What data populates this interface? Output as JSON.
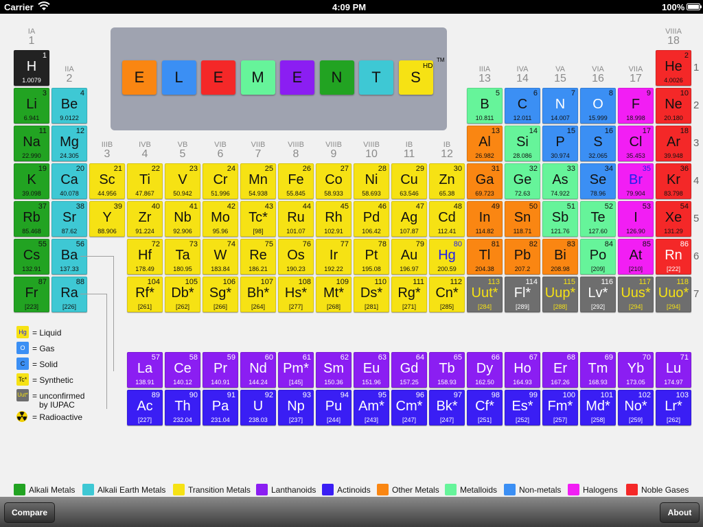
{
  "status": {
    "carrier": "Carrier",
    "time": "4:09 PM",
    "battery": "100%"
  },
  "title_letters": [
    "E",
    "L",
    "E",
    "M",
    "E",
    "N",
    "T",
    "S"
  ],
  "title_hd": "HD",
  "title_tm": "TM",
  "colors": {
    "alkali": "#22a322",
    "alkaline": "#3ec8d4",
    "transition": "#f6e214",
    "lanthanoid": "#8b1ef2",
    "actinoid": "#3a1ef4",
    "other": "#fa8612",
    "metalloid": "#66f49a",
    "nonmetal": "#3b8ff4",
    "halogen": "#f21ef4",
    "noble": "#f42828",
    "unknown": "#6e6e6e",
    "hydrogen": "#222222"
  },
  "group_labels": [
    {
      "roman": "IA",
      "arabic": "1"
    },
    {
      "roman": "IIA",
      "arabic": "2"
    },
    {
      "roman": "IIIB",
      "arabic": "3"
    },
    {
      "roman": "IVB",
      "arabic": "4"
    },
    {
      "roman": "VB",
      "arabic": "5"
    },
    {
      "roman": "VIB",
      "arabic": "6"
    },
    {
      "roman": "VIIB",
      "arabic": "7"
    },
    {
      "roman": "VIIIB",
      "arabic": "8"
    },
    {
      "roman": "VIIIB",
      "arabic": "9"
    },
    {
      "roman": "VIIIB",
      "arabic": "10"
    },
    {
      "roman": "IB",
      "arabic": "11"
    },
    {
      "roman": "IB",
      "arabic": "12"
    },
    {
      "roman": "IIIA",
      "arabic": "13"
    },
    {
      "roman": "IVA",
      "arabic": "14"
    },
    {
      "roman": "VA",
      "arabic": "15"
    },
    {
      "roman": "VIA",
      "arabic": "16"
    },
    {
      "roman": "VIIA",
      "arabic": "17"
    },
    {
      "roman": "VIIIA",
      "arabic": "18"
    }
  ],
  "periods": [
    "1",
    "2",
    "3",
    "4",
    "5",
    "6",
    "7"
  ],
  "elements": [
    {
      "n": "1",
      "s": "H",
      "m": "1.0079",
      "r": 1,
      "c": 1,
      "t": "hydrogen"
    },
    {
      "n": "2",
      "s": "He",
      "m": "4.0026",
      "r": 1,
      "c": 18,
      "t": "noble"
    },
    {
      "n": "3",
      "s": "Li",
      "m": "6.941",
      "r": 2,
      "c": 1,
      "t": "alkali"
    },
    {
      "n": "4",
      "s": "Be",
      "m": "9.0122",
      "r": 2,
      "c": 2,
      "t": "alkaline"
    },
    {
      "n": "5",
      "s": "B",
      "m": "10.811",
      "r": 2,
      "c": 13,
      "t": "metalloid"
    },
    {
      "n": "6",
      "s": "C",
      "m": "12.011",
      "r": 2,
      "c": 14,
      "t": "nonmetal"
    },
    {
      "n": "7",
      "s": "N",
      "m": "14.007",
      "r": 2,
      "c": 15,
      "t": "nonmetal"
    },
    {
      "n": "8",
      "s": "O",
      "m": "15.999",
      "r": 2,
      "c": 16,
      "t": "nonmetal"
    },
    {
      "n": "9",
      "s": "F",
      "m": "18.998",
      "r": 2,
      "c": 17,
      "t": "halogen"
    },
    {
      "n": "10",
      "s": "Ne",
      "m": "20.180",
      "r": 2,
      "c": 18,
      "t": "noble"
    },
    {
      "n": "11",
      "s": "Na",
      "m": "22.990",
      "r": 3,
      "c": 1,
      "t": "alkali"
    },
    {
      "n": "12",
      "s": "Mg",
      "m": "24.305",
      "r": 3,
      "c": 2,
      "t": "alkaline"
    },
    {
      "n": "13",
      "s": "Al",
      "m": "26.982",
      "r": 3,
      "c": 13,
      "t": "other"
    },
    {
      "n": "14",
      "s": "Si",
      "m": "28.086",
      "r": 3,
      "c": 14,
      "t": "metalloid"
    },
    {
      "n": "15",
      "s": "P",
      "m": "30.974",
      "r": 3,
      "c": 15,
      "t": "nonmetal"
    },
    {
      "n": "16",
      "s": "S",
      "m": "32.065",
      "r": 3,
      "c": 16,
      "t": "nonmetal"
    },
    {
      "n": "17",
      "s": "Cl",
      "m": "35.453",
      "r": 3,
      "c": 17,
      "t": "halogen"
    },
    {
      "n": "18",
      "s": "Ar",
      "m": "39.948",
      "r": 3,
      "c": 18,
      "t": "noble"
    },
    {
      "n": "19",
      "s": "K",
      "m": "39.098",
      "r": 4,
      "c": 1,
      "t": "alkali"
    },
    {
      "n": "20",
      "s": "Ca",
      "m": "40.078",
      "r": 4,
      "c": 2,
      "t": "alkaline"
    },
    {
      "n": "21",
      "s": "Sc",
      "m": "44.956",
      "r": 4,
      "c": 3,
      "t": "transition"
    },
    {
      "n": "22",
      "s": "Ti",
      "m": "47.867",
      "r": 4,
      "c": 4,
      "t": "transition"
    },
    {
      "n": "23",
      "s": "V",
      "m": "50.942",
      "r": 4,
      "c": 5,
      "t": "transition"
    },
    {
      "n": "24",
      "s": "Cr",
      "m": "51.996",
      "r": 4,
      "c": 6,
      "t": "transition"
    },
    {
      "n": "25",
      "s": "Mn",
      "m": "54.938",
      "r": 4,
      "c": 7,
      "t": "transition"
    },
    {
      "n": "26",
      "s": "Fe",
      "m": "55.845",
      "r": 4,
      "c": 8,
      "t": "transition"
    },
    {
      "n": "27",
      "s": "Co",
      "m": "58.933",
      "r": 4,
      "c": 9,
      "t": "transition"
    },
    {
      "n": "28",
      "s": "Ni",
      "m": "58.693",
      "r": 4,
      "c": 10,
      "t": "transition"
    },
    {
      "n": "29",
      "s": "Cu",
      "m": "63.546",
      "r": 4,
      "c": 11,
      "t": "transition"
    },
    {
      "n": "30",
      "s": "Zn",
      "m": "65.38",
      "r": 4,
      "c": 12,
      "t": "transition"
    },
    {
      "n": "31",
      "s": "Ga",
      "m": "69.723",
      "r": 4,
      "c": 13,
      "t": "other"
    },
    {
      "n": "32",
      "s": "Ge",
      "m": "72.63",
      "r": 4,
      "c": 14,
      "t": "metalloid"
    },
    {
      "n": "33",
      "s": "As",
      "m": "74.922",
      "r": 4,
      "c": 15,
      "t": "metalloid"
    },
    {
      "n": "34",
      "s": "Se",
      "m": "78.96",
      "r": 4,
      "c": 16,
      "t": "nonmetal"
    },
    {
      "n": "35",
      "s": "Br",
      "m": "79.904",
      "r": 4,
      "c": 17,
      "t": "halogen",
      "blue": true
    },
    {
      "n": "36",
      "s": "Kr",
      "m": "83.798",
      "r": 4,
      "c": 18,
      "t": "noble"
    },
    {
      "n": "37",
      "s": "Rb",
      "m": "85.468",
      "r": 5,
      "c": 1,
      "t": "alkali"
    },
    {
      "n": "38",
      "s": "Sr",
      "m": "87.62",
      "r": 5,
      "c": 2,
      "t": "alkaline"
    },
    {
      "n": "39",
      "s": "Y",
      "m": "88.906",
      "r": 5,
      "c": 3,
      "t": "transition"
    },
    {
      "n": "40",
      "s": "Zr",
      "m": "91.224",
      "r": 5,
      "c": 4,
      "t": "transition"
    },
    {
      "n": "41",
      "s": "Nb",
      "m": "92.906",
      "r": 5,
      "c": 5,
      "t": "transition"
    },
    {
      "n": "42",
      "s": "Mo",
      "m": "95.96",
      "r": 5,
      "c": 6,
      "t": "transition"
    },
    {
      "n": "43",
      "s": "Tc*",
      "m": "[98]",
      "r": 5,
      "c": 7,
      "t": "transition"
    },
    {
      "n": "44",
      "s": "Ru",
      "m": "101.07",
      "r": 5,
      "c": 8,
      "t": "transition"
    },
    {
      "n": "45",
      "s": "Rh",
      "m": "102.91",
      "r": 5,
      "c": 9,
      "t": "transition"
    },
    {
      "n": "46",
      "s": "Pd",
      "m": "106.42",
      "r": 5,
      "c": 10,
      "t": "transition"
    },
    {
      "n": "47",
      "s": "Ag",
      "m": "107.87",
      "r": 5,
      "c": 11,
      "t": "transition"
    },
    {
      "n": "48",
      "s": "Cd",
      "m": "112.41",
      "r": 5,
      "c": 12,
      "t": "transition"
    },
    {
      "n": "49",
      "s": "In",
      "m": "114.82",
      "r": 5,
      "c": 13,
      "t": "other"
    },
    {
      "n": "50",
      "s": "Sn",
      "m": "118.71",
      "r": 5,
      "c": 14,
      "t": "other"
    },
    {
      "n": "51",
      "s": "Sb",
      "m": "121.76",
      "r": 5,
      "c": 15,
      "t": "metalloid"
    },
    {
      "n": "52",
      "s": "Te",
      "m": "127.60",
      "r": 5,
      "c": 16,
      "t": "metalloid"
    },
    {
      "n": "53",
      "s": "I",
      "m": "126.90",
      "r": 5,
      "c": 17,
      "t": "halogen"
    },
    {
      "n": "54",
      "s": "Xe",
      "m": "131.29",
      "r": 5,
      "c": 18,
      "t": "noble"
    },
    {
      "n": "55",
      "s": "Cs",
      "m": "132.91",
      "r": 6,
      "c": 1,
      "t": "alkali"
    },
    {
      "n": "56",
      "s": "Ba",
      "m": "137.33",
      "r": 6,
      "c": 2,
      "t": "alkaline"
    },
    {
      "n": "72",
      "s": "Hf",
      "m": "178.49",
      "r": 6,
      "c": 4,
      "t": "transition"
    },
    {
      "n": "73",
      "s": "Ta",
      "m": "180.95",
      "r": 6,
      "c": 5,
      "t": "transition"
    },
    {
      "n": "74",
      "s": "W",
      "m": "183.84",
      "r": 6,
      "c": 6,
      "t": "transition"
    },
    {
      "n": "75",
      "s": "Re",
      "m": "186.21",
      "r": 6,
      "c": 7,
      "t": "transition"
    },
    {
      "n": "76",
      "s": "Os",
      "m": "190.23",
      "r": 6,
      "c": 8,
      "t": "transition"
    },
    {
      "n": "77",
      "s": "Ir",
      "m": "192.22",
      "r": 6,
      "c": 9,
      "t": "transition"
    },
    {
      "n": "78",
      "s": "Pt",
      "m": "195.08",
      "r": 6,
      "c": 10,
      "t": "transition"
    },
    {
      "n": "79",
      "s": "Au",
      "m": "196.97",
      "r": 6,
      "c": 11,
      "t": "transition"
    },
    {
      "n": "80",
      "s": "Hg",
      "m": "200.59",
      "r": 6,
      "c": 12,
      "t": "transition",
      "blue": true
    },
    {
      "n": "81",
      "s": "Tl",
      "m": "204.38",
      "r": 6,
      "c": 13,
      "t": "other"
    },
    {
      "n": "82",
      "s": "Pb",
      "m": "207.2",
      "r": 6,
      "c": 14,
      "t": "other"
    },
    {
      "n": "83",
      "s": "Bi",
      "m": "208.98",
      "r": 6,
      "c": 15,
      "t": "other"
    },
    {
      "n": "84",
      "s": "Po",
      "m": "[209]",
      "r": 6,
      "c": 16,
      "t": "metalloid"
    },
    {
      "n": "85",
      "s": "At",
      "m": "[210]",
      "r": 6,
      "c": 17,
      "t": "halogen"
    },
    {
      "n": "86",
      "s": "Rn",
      "m": "[222]",
      "r": 6,
      "c": 18,
      "t": "noble",
      "white": true
    },
    {
      "n": "87",
      "s": "Fr",
      "m": "[223]",
      "r": 7,
      "c": 1,
      "t": "alkali"
    },
    {
      "n": "88",
      "s": "Ra",
      "m": "[226]",
      "r": 7,
      "c": 2,
      "t": "alkaline"
    },
    {
      "n": "104",
      "s": "Rf*",
      "m": "[261]",
      "r": 7,
      "c": 4,
      "t": "transition"
    },
    {
      "n": "105",
      "s": "Db*",
      "m": "[262]",
      "r": 7,
      "c": 5,
      "t": "transition"
    },
    {
      "n": "106",
      "s": "Sg*",
      "m": "[266]",
      "r": 7,
      "c": 6,
      "t": "transition"
    },
    {
      "n": "107",
      "s": "Bh*",
      "m": "[264]",
      "r": 7,
      "c": 7,
      "t": "transition"
    },
    {
      "n": "108",
      "s": "Hs*",
      "m": "[277]",
      "r": 7,
      "c": 8,
      "t": "transition"
    },
    {
      "n": "109",
      "s": "Mt*",
      "m": "[268]",
      "r": 7,
      "c": 9,
      "t": "transition"
    },
    {
      "n": "110",
      "s": "Ds*",
      "m": "[281]",
      "r": 7,
      "c": 10,
      "t": "transition"
    },
    {
      "n": "111",
      "s": "Rg*",
      "m": "[271]",
      "r": 7,
      "c": 11,
      "t": "transition"
    },
    {
      "n": "112",
      "s": "Cn*",
      "m": "[285]",
      "r": 7,
      "c": 12,
      "t": "transition"
    },
    {
      "n": "113",
      "s": "Uut*",
      "m": "[284]",
      "r": 7,
      "c": 13,
      "t": "unknown",
      "yellowtxt": true
    },
    {
      "n": "114",
      "s": "Fl*",
      "m": "[289]",
      "r": 7,
      "c": 14,
      "t": "unknown"
    },
    {
      "n": "115",
      "s": "Uup*",
      "m": "[288]",
      "r": 7,
      "c": 15,
      "t": "unknown",
      "yellowtxt": true
    },
    {
      "n": "116",
      "s": "Lv*",
      "m": "[292]",
      "r": 7,
      "c": 16,
      "t": "unknown"
    },
    {
      "n": "117",
      "s": "Uus*",
      "m": "[294]",
      "r": 7,
      "c": 17,
      "t": "unknown",
      "yellowtxt": true
    },
    {
      "n": "118",
      "s": "Uuo*",
      "m": "[294]",
      "r": 7,
      "c": 18,
      "t": "unknown",
      "yellowtxt": true
    },
    {
      "n": "57",
      "s": "La",
      "m": "138.91",
      "r": 9,
      "c": 4,
      "t": "lanthanoid"
    },
    {
      "n": "58",
      "s": "Ce",
      "m": "140.12",
      "r": 9,
      "c": 5,
      "t": "lanthanoid"
    },
    {
      "n": "59",
      "s": "Pr",
      "m": "140.91",
      "r": 9,
      "c": 6,
      "t": "lanthanoid"
    },
    {
      "n": "60",
      "s": "Nd",
      "m": "144.24",
      "r": 9,
      "c": 7,
      "t": "lanthanoid"
    },
    {
      "n": "61",
      "s": "Pm*",
      "m": "[145]",
      "r": 9,
      "c": 8,
      "t": "lanthanoid"
    },
    {
      "n": "62",
      "s": "Sm",
      "m": "150.36",
      "r": 9,
      "c": 9,
      "t": "lanthanoid"
    },
    {
      "n": "63",
      "s": "Eu",
      "m": "151.96",
      "r": 9,
      "c": 10,
      "t": "lanthanoid"
    },
    {
      "n": "64",
      "s": "Gd",
      "m": "157.25",
      "r": 9,
      "c": 11,
      "t": "lanthanoid"
    },
    {
      "n": "65",
      "s": "Tb",
      "m": "158.93",
      "r": 9,
      "c": 12,
      "t": "lanthanoid"
    },
    {
      "n": "66",
      "s": "Dy",
      "m": "162.50",
      "r": 9,
      "c": 13,
      "t": "lanthanoid"
    },
    {
      "n": "67",
      "s": "Ho",
      "m": "164.93",
      "r": 9,
      "c": 14,
      "t": "lanthanoid"
    },
    {
      "n": "68",
      "s": "Er",
      "m": "167.26",
      "r": 9,
      "c": 15,
      "t": "lanthanoid"
    },
    {
      "n": "69",
      "s": "Tm",
      "m": "168.93",
      "r": 9,
      "c": 16,
      "t": "lanthanoid"
    },
    {
      "n": "70",
      "s": "Yb",
      "m": "173.05",
      "r": 9,
      "c": 17,
      "t": "lanthanoid"
    },
    {
      "n": "71",
      "s": "Lu",
      "m": "174.97",
      "r": 9,
      "c": 18,
      "t": "lanthanoid"
    },
    {
      "n": "89",
      "s": "Ac",
      "m": "[227]",
      "r": 10,
      "c": 4,
      "t": "actinoid"
    },
    {
      "n": "90",
      "s": "Th",
      "m": "232.04",
      "r": 10,
      "c": 5,
      "t": "actinoid"
    },
    {
      "n": "91",
      "s": "Pa",
      "m": "231.04",
      "r": 10,
      "c": 6,
      "t": "actinoid"
    },
    {
      "n": "92",
      "s": "U",
      "m": "238.03",
      "r": 10,
      "c": 7,
      "t": "actinoid"
    },
    {
      "n": "93",
      "s": "Np",
      "m": "[237]",
      "r": 10,
      "c": 8,
      "t": "actinoid"
    },
    {
      "n": "94",
      "s": "Pu",
      "m": "[244]",
      "r": 10,
      "c": 9,
      "t": "actinoid"
    },
    {
      "n": "95",
      "s": "Am*",
      "m": "[243]",
      "r": 10,
      "c": 10,
      "t": "actinoid"
    },
    {
      "n": "96",
      "s": "Cm*",
      "m": "[247]",
      "r": 10,
      "c": 11,
      "t": "actinoid"
    },
    {
      "n": "97",
      "s": "Bk*",
      "m": "[247]",
      "r": 10,
      "c": 12,
      "t": "actinoid"
    },
    {
      "n": "98",
      "s": "Cf*",
      "m": "[251]",
      "r": 10,
      "c": 13,
      "t": "actinoid"
    },
    {
      "n": "99",
      "s": "Es*",
      "m": "[252]",
      "r": 10,
      "c": 14,
      "t": "actinoid"
    },
    {
      "n": "100",
      "s": "Fm*",
      "m": "[257]",
      "r": 10,
      "c": 15,
      "t": "actinoid"
    },
    {
      "n": "101",
      "s": "Md*",
      "m": "[258]",
      "r": 10,
      "c": 16,
      "t": "actinoid"
    },
    {
      "n": "102",
      "s": "No*",
      "m": "[259]",
      "r": 10,
      "c": 17,
      "t": "actinoid"
    },
    {
      "n": "103",
      "s": "Lr*",
      "m": "[262]",
      "r": 10,
      "c": 18,
      "t": "actinoid"
    }
  ],
  "key": {
    "liquid_sample": "Hg",
    "liquid_label": "= Liquid",
    "gas_sample": "O",
    "gas_label": "= Gas",
    "solid_sample": "C",
    "solid_label": "= Solid",
    "synthetic_sample": "Tc*",
    "synthetic_label": "= Synthetic",
    "unconfirmed_sample": "Uut*",
    "unconfirmed_label_1": "= unconfirmed",
    "unconfirmed_label_2": "by IUPAC",
    "radioactive_label": "= Radioactive"
  },
  "legend": {
    "alkali": "Alkali Metals",
    "alkaline": "Alkali Earth Metals",
    "transition": "Transition Metals",
    "lanthanoid": "Lanthanoids",
    "actinoid": "Actinoids",
    "other": "Other Metals",
    "metalloid": "Metalloids",
    "nonmetal": "Non-metals",
    "halogen": "Halogens",
    "noble": "Noble Gases"
  },
  "toolbar": {
    "compare_label": "Compare",
    "about_label": "About"
  }
}
